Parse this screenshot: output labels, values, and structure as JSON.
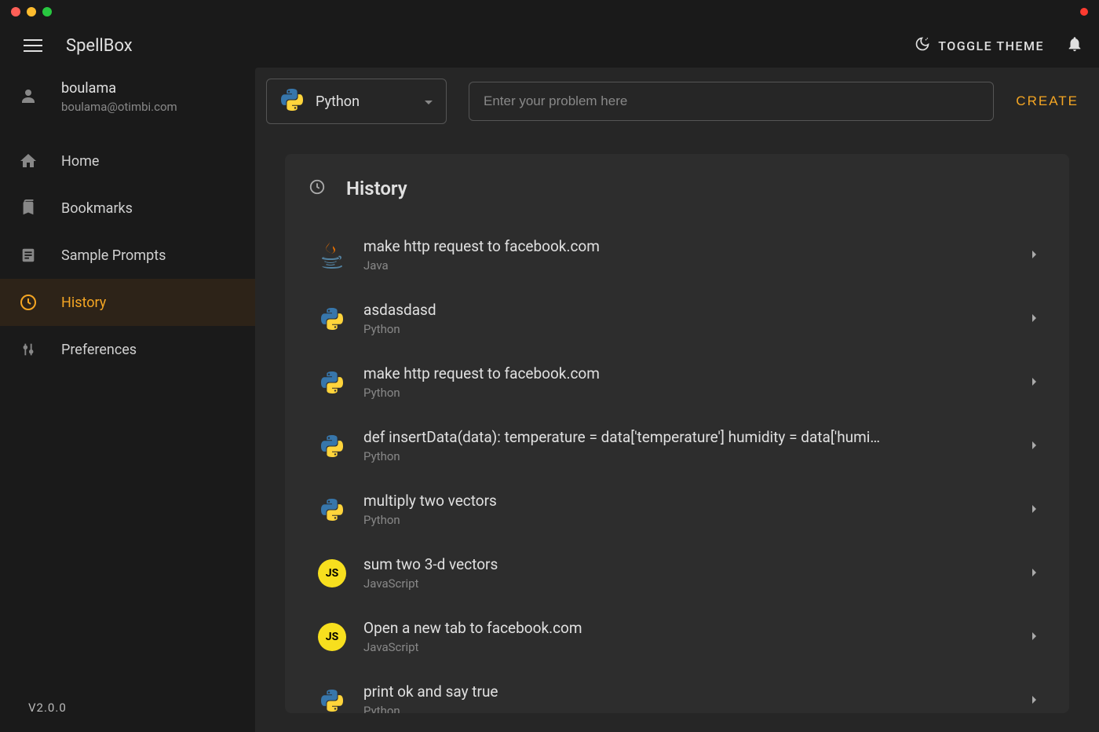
{
  "app": {
    "title": "SpellBox",
    "version": "V2.0.0"
  },
  "header": {
    "toggleTheme": "TOGGLE THEME"
  },
  "user": {
    "name": "boulama",
    "email": "boulama@otimbi.com"
  },
  "sidebar": {
    "items": [
      {
        "label": "Home",
        "icon": "home"
      },
      {
        "label": "Bookmarks",
        "icon": "bookmark"
      },
      {
        "label": "Sample Prompts",
        "icon": "document"
      },
      {
        "label": "History",
        "icon": "clock",
        "active": true
      },
      {
        "label": "Preferences",
        "icon": "sliders"
      }
    ]
  },
  "toolbar": {
    "selectedLanguage": "Python",
    "inputPlaceholder": "Enter your problem here",
    "createLabel": "CREATE"
  },
  "panel": {
    "title": "History"
  },
  "history": [
    {
      "title": "make http request to facebook.com",
      "language": "Java",
      "icon": "java"
    },
    {
      "title": "asdasdasd",
      "language": "Python",
      "icon": "python"
    },
    {
      "title": "make http request to facebook.com",
      "language": "Python",
      "icon": "python"
    },
    {
      "title": "def insertData(data): temperature = data['temperature'] humidity = data['humi…",
      "language": "Python",
      "icon": "python"
    },
    {
      "title": "multiply two vectors",
      "language": "Python",
      "icon": "python"
    },
    {
      "title": "sum two 3-d vectors",
      "language": "JavaScript",
      "icon": "javascript"
    },
    {
      "title": "Open a new tab to facebook.com",
      "language": "JavaScript",
      "icon": "javascript"
    },
    {
      "title": "print ok and say true",
      "language": "Python",
      "icon": "python"
    }
  ]
}
